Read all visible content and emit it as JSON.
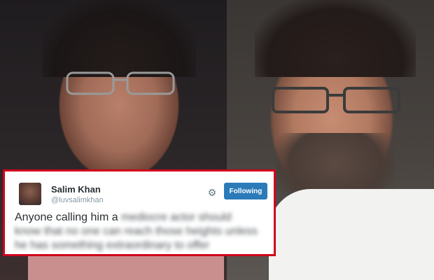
{
  "tweet": {
    "name": "Salim Khan",
    "handle": "@luvsalimkhan",
    "follow_label": "Following",
    "text_visible": "Anyone calling him a",
    "text_blurred_1": "mediocre actor should",
    "text_blurred_2": "know that no one can reach those heights unless",
    "text_blurred_3": "he has something extraordinary to offer",
    "settings_icon": "gear-icon",
    "accent_color": "#2b7bb9",
    "border_color": "#d0021b"
  },
  "photos": {
    "left_subject_icon": "person-photo",
    "right_subject_icon": "person-photo"
  }
}
